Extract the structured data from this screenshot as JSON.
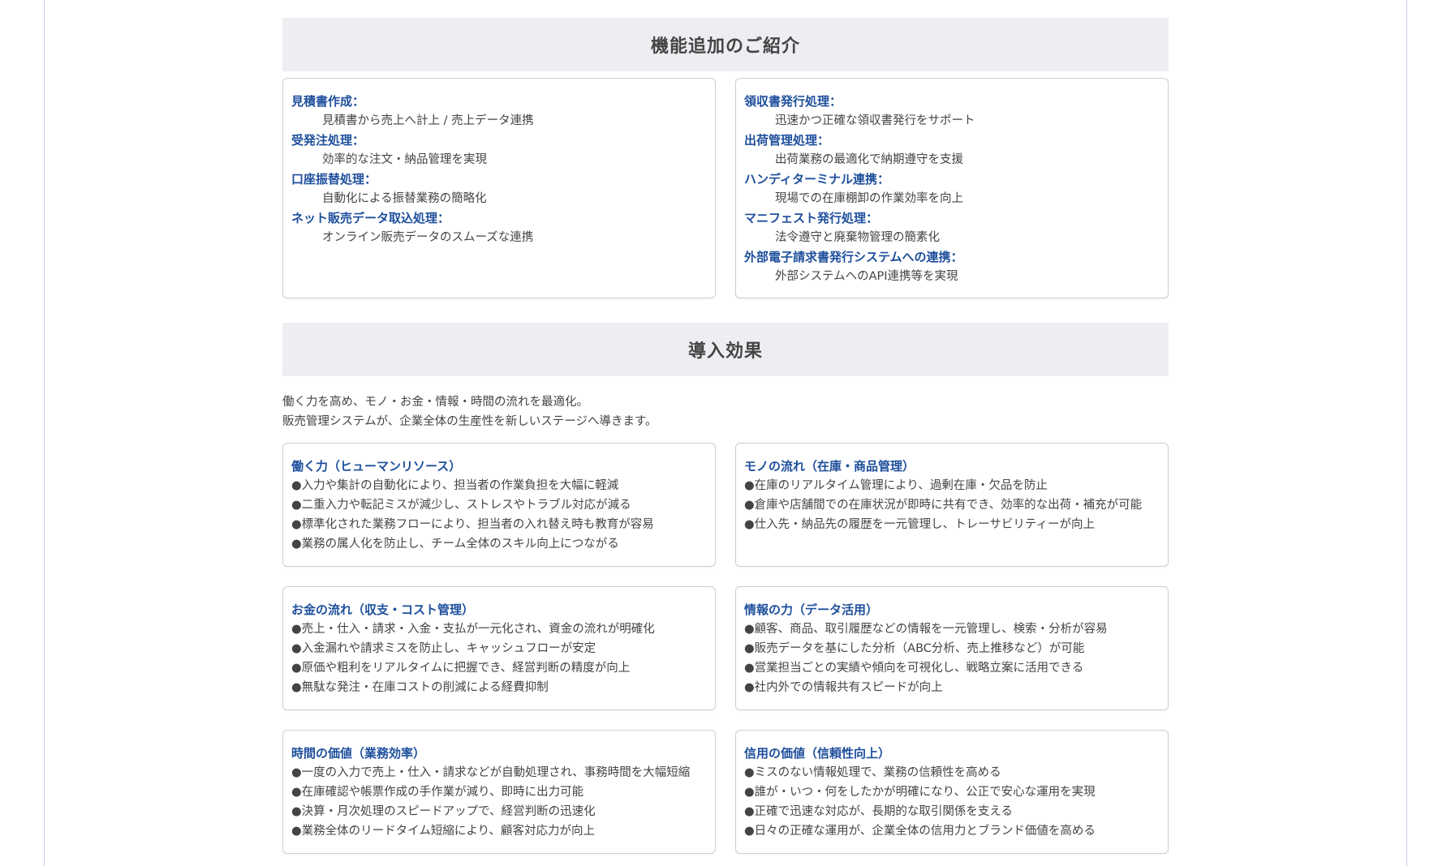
{
  "features": {
    "heading": "機能追加のご紹介",
    "left": [
      {
        "title": "見積書作成：",
        "desc": "見積書から売上へ計上 / 売上データ連携"
      },
      {
        "title": "受発注処理：",
        "desc": "効率的な注文・納品管理を実現"
      },
      {
        "title": "口座振替処理：",
        "desc": "自動化による振替業務の簡略化"
      },
      {
        "title": "ネット販売データ取込処理：",
        "desc": "オンライン販売データのスムーズな連携"
      }
    ],
    "right": [
      {
        "title": "領収書発行処理：",
        "desc": "迅速かつ正確な領収書発行をサポート"
      },
      {
        "title": "出荷管理処理：",
        "desc": "出荷業務の最適化で納期遵守を支援"
      },
      {
        "title": "ハンディターミナル連携：",
        "desc": "現場での在庫棚卸の作業効率を向上"
      },
      {
        "title": "マニフェスト発行処理：",
        "desc": "法令遵守と廃棄物管理の簡素化"
      },
      {
        "title": "外部電子請求書発行システムへの連携：",
        "desc": "外部システムへのAPI連携等を実現"
      }
    ]
  },
  "effects": {
    "heading": "導入効果",
    "intro": [
      "働く力を高め、モノ・お金・情報・時間の流れを最適化。",
      "販売管理システムが、企業全体の生産性を新しいステージへ導きます。"
    ],
    "cards": [
      {
        "title": "働く力（ヒューマンリソース）",
        "items": [
          "●入力や集計の自動化により、担当者の作業負担を大幅に軽減",
          "●二重入力や転記ミスが減少し、ストレスやトラブル対応が減る",
          "●標準化された業務フローにより、担当者の入れ替え時も教育が容易",
          "●業務の属人化を防止し、チーム全体のスキル向上につながる"
        ]
      },
      {
        "title": "モノの流れ（在庫・商品管理）",
        "items": [
          "●在庫のリアルタイム管理により、過剰在庫・欠品を防止",
          "●倉庫や店舗間での在庫状況が即時に共有でき、効率的な出荷・補充が可能",
          "●仕入先・納品先の履歴を一元管理し、トレーサビリティーが向上"
        ]
      },
      {
        "title": "お金の流れ（収支・コスト管理）",
        "items": [
          "●売上・仕入・請求・入金・支払が一元化され、資金の流れが明確化",
          "●入金漏れや請求ミスを防止し、キャッシュフローが安定",
          "●原価や粗利をリアルタイムに把握でき、経営判断の精度が向上",
          "●無駄な発注・在庫コストの削減による経費抑制"
        ]
      },
      {
        "title": "情報の力（データ活用）",
        "items": [
          "●顧客、商品、取引履歴などの情報を一元管理し、検索・分析が容易",
          "●販売データを基にした分析（ABC分析、売上推移など）が可能",
          "●営業担当ごとの実績や傾向を可視化し、戦略立案に活用できる",
          "●社内外での情報共有スピードが向上"
        ]
      },
      {
        "title": "時間の価値（業務効率）",
        "items": [
          "●一度の入力で売上・仕入・請求などが自動処理され、事務時間を大幅短縮",
          "●在庫確認や帳票作成の手作業が減り、即時に出力可能",
          "●決算・月次処理のスピードアップで、経営判断の迅速化",
          "●業務全体のリードタイム短縮により、顧客対応力が向上"
        ]
      },
      {
        "title": "信用の価値（信頼性向上）",
        "items": [
          "●ミスのない情報処理で、業務の信頼性を高める",
          "●誰が・いつ・何をしたかが明確になり、公正で安心な運用を実現",
          "●正確で迅速な対応が、長期的な取引関係を支える",
          "●日々の正確な運用が、企業全体の信用力とブランド価値を高める"
        ]
      }
    ]
  }
}
